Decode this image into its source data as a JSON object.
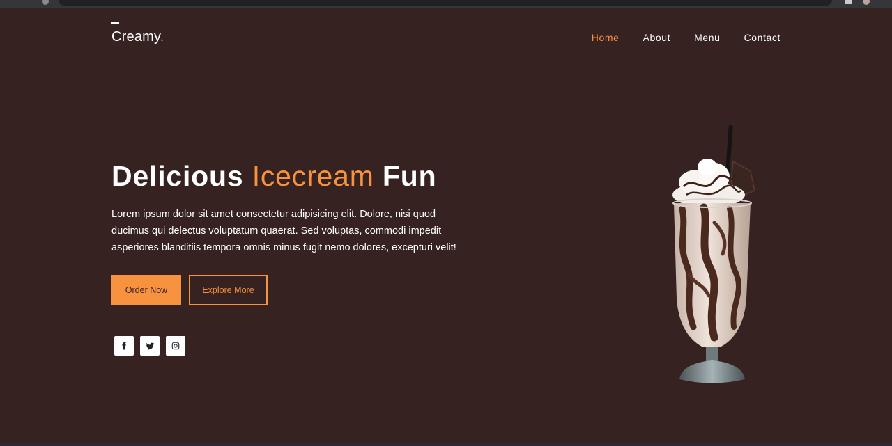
{
  "brand": {
    "name": "Creamy",
    "dot": ".",
    "accent_color": "#f7923e"
  },
  "nav": {
    "items": [
      {
        "label": "Home",
        "active": true
      },
      {
        "label": "About",
        "active": false
      },
      {
        "label": "Menu",
        "active": false
      },
      {
        "label": "Contact",
        "active": false
      }
    ]
  },
  "hero": {
    "title_part1": "Delicious",
    "title_accent": "Icecream",
    "title_part2": "Fun",
    "description": "Lorem ipsum dolor sit amet consectetur adipisicing elit. Dolore, nisi quod ducimus qui delectus voluptatum quaerat. Sed voluptas, commodi impedit asperiores blanditiis tempora omnis minus fugit nemo dolores, excepturi velit!",
    "primary_button": "Order Now",
    "secondary_button": "Explore More"
  },
  "socials": [
    {
      "icon": "facebook-icon"
    },
    {
      "icon": "twitter-icon"
    },
    {
      "icon": "instagram-icon"
    }
  ],
  "colors": {
    "background": "#362220",
    "accent": "#f7923e",
    "text": "#ffffff"
  }
}
